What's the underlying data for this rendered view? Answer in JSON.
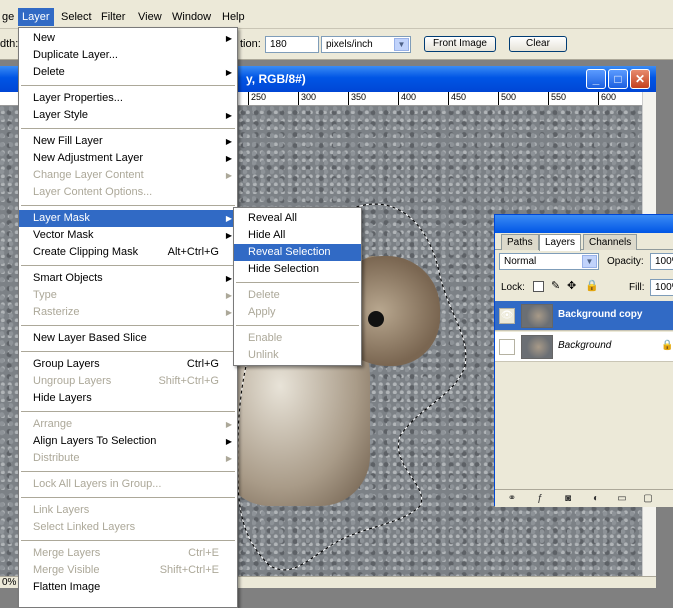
{
  "menubar": {
    "items": [
      "ge",
      "Layer",
      "Select",
      "Filter",
      "View",
      "Window",
      "Help"
    ],
    "active_index": 1
  },
  "options_bar": {
    "left_label": "dth:",
    "resolution_label": "tion:",
    "resolution_value": "180",
    "units_value": "pixels/inch",
    "front_image_label": "Front Image",
    "clear_label": "Clear"
  },
  "document": {
    "title": "y, RGB/8#)",
    "zoom_status": "0%",
    "ruler_ticks": [
      "250",
      "300",
      "350",
      "400",
      "450",
      "500",
      "550",
      "600"
    ]
  },
  "layers_panel": {
    "tabs": [
      "Paths",
      "Layers",
      "Channels"
    ],
    "active_tab": "Layers",
    "blend_mode": "Normal",
    "opacity_label": "Opacity:",
    "opacity_value": "100%",
    "lock_label": "Lock:",
    "fill_label": "Fill:",
    "fill_value": "100%",
    "layers": [
      {
        "name": "Background copy",
        "selected": true,
        "visible": true
      },
      {
        "name": "Background",
        "selected": false,
        "visible": false,
        "locked": true
      }
    ]
  },
  "layer_menu": {
    "items": [
      {
        "label": "New",
        "submenu": true
      },
      {
        "label": "Duplicate Layer...",
        "submenu": false
      },
      {
        "label": "Delete",
        "submenu": true
      },
      {
        "sep": true
      },
      {
        "label": "Layer Properties...",
        "submenu": false
      },
      {
        "label": "Layer Style",
        "submenu": true
      },
      {
        "sep": true
      },
      {
        "label": "New Fill Layer",
        "submenu": true
      },
      {
        "label": "New Adjustment Layer",
        "submenu": true
      },
      {
        "label": "Change Layer Content",
        "submenu": true,
        "disabled": true
      },
      {
        "label": "Layer Content Options...",
        "disabled": true
      },
      {
        "sep": true
      },
      {
        "label": "Layer Mask",
        "submenu": true,
        "highlighted": true
      },
      {
        "label": "Vector Mask",
        "submenu": true
      },
      {
        "label": "Create Clipping Mask",
        "shortcut": "Alt+Ctrl+G"
      },
      {
        "sep": true
      },
      {
        "label": "Smart Objects",
        "submenu": true
      },
      {
        "label": "Type",
        "submenu": true,
        "disabled": true
      },
      {
        "label": "Rasterize",
        "submenu": true,
        "disabled": true
      },
      {
        "sep": true
      },
      {
        "label": "New Layer Based Slice"
      },
      {
        "sep": true
      },
      {
        "label": "Group Layers",
        "shortcut": "Ctrl+G"
      },
      {
        "label": "Ungroup Layers",
        "shortcut": "Shift+Ctrl+G",
        "disabled": true
      },
      {
        "label": "Hide Layers"
      },
      {
        "sep": true
      },
      {
        "label": "Arrange",
        "submenu": true,
        "disabled": true
      },
      {
        "label": "Align Layers To Selection",
        "submenu": true
      },
      {
        "label": "Distribute",
        "submenu": true,
        "disabled": true
      },
      {
        "sep": true
      },
      {
        "label": "Lock All Layers in Group...",
        "disabled": true
      },
      {
        "sep": true
      },
      {
        "label": "Link Layers",
        "disabled": true
      },
      {
        "label": "Select Linked Layers",
        "disabled": true
      },
      {
        "sep": true
      },
      {
        "label": "Merge Layers",
        "shortcut": "Ctrl+E",
        "disabled": true
      },
      {
        "label": "Merge Visible",
        "shortcut": "Shift+Ctrl+E",
        "disabled": true
      },
      {
        "label": "Flatten Image"
      }
    ]
  },
  "layer_mask_submenu": {
    "items": [
      {
        "label": "Reveal All"
      },
      {
        "label": "Hide All"
      },
      {
        "label": "Reveal Selection",
        "highlighted": true
      },
      {
        "label": "Hide Selection"
      },
      {
        "sep": true
      },
      {
        "label": "Delete",
        "disabled": true
      },
      {
        "label": "Apply",
        "disabled": true
      },
      {
        "sep": true
      },
      {
        "label": "Enable",
        "disabled": true
      },
      {
        "label": "Unlink",
        "disabled": true
      }
    ]
  },
  "colors": {
    "highlight": "#316ac5",
    "menubar_bg": "#ece9d8",
    "xp_title_blue": "#0055e5"
  }
}
